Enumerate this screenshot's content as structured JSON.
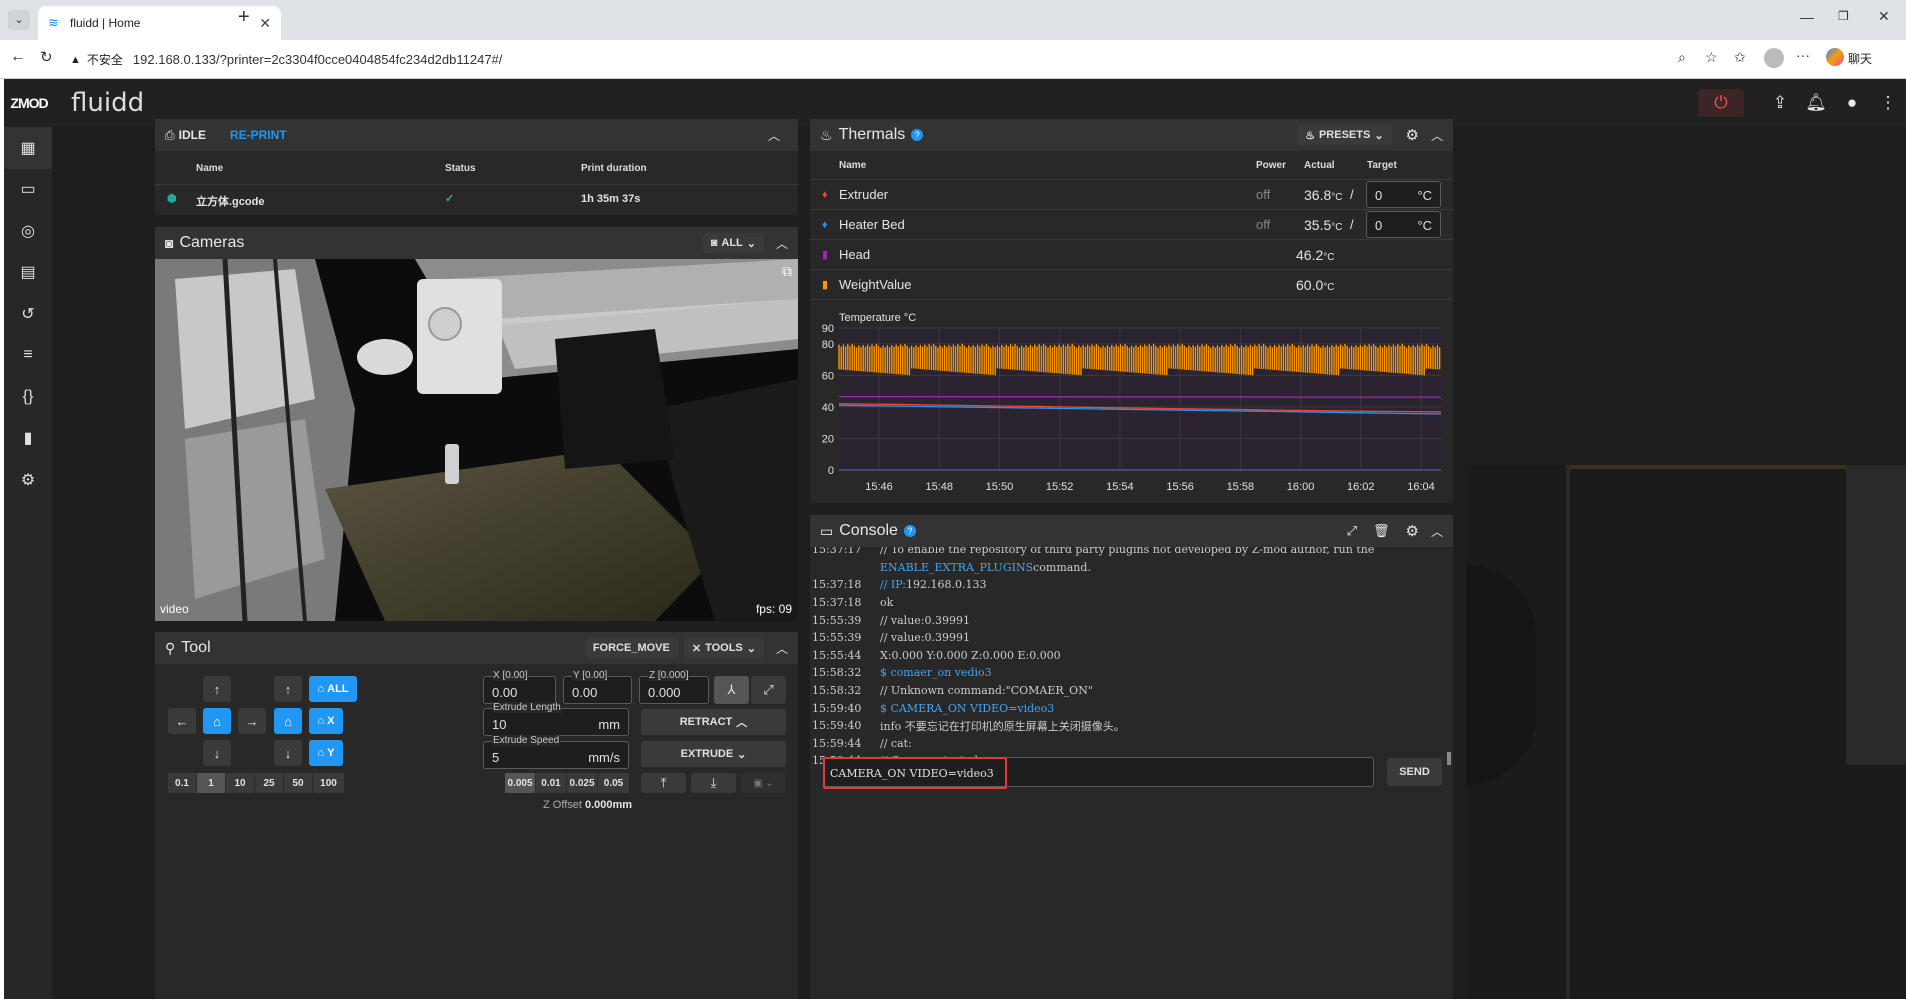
{
  "browser": {
    "tab_title": "fluidd | Home",
    "security_label": "不安全",
    "url": "192.168.0.133/?printer=2c3304f0cce0404854fc234d2db11247#/",
    "profile_label": "聊天"
  },
  "app": {
    "logo": "ZMOD",
    "brand": "fluidd"
  },
  "sidebar": {
    "items": [
      "dashboard",
      "console",
      "camera",
      "files",
      "history",
      "tune",
      "macros",
      "system",
      "settings"
    ]
  },
  "job": {
    "state": "IDLE",
    "reprint": "RE-PRINT",
    "columns": [
      "Name",
      "Status",
      "Print duration"
    ],
    "file": "立方体.gcode",
    "duration": "1h 35m 37s"
  },
  "cameras": {
    "title": "Cameras",
    "all_button": "ALL",
    "label": "video",
    "fps": "fps: 09"
  },
  "tool": {
    "title": "Tool",
    "force_move": "FORCE_MOVE",
    "tools": "TOOLS",
    "home_all": "ALL",
    "home_x": "X",
    "home_y": "Y",
    "steps": [
      "0.1",
      "1",
      "10",
      "25",
      "50",
      "100"
    ],
    "x_label": "X [0.00]",
    "x_val": "0.00",
    "y_label": "Y [0.00]",
    "y_val": "0.00",
    "z_label": "Z [0.000]",
    "z_val": "0.000",
    "extrude_length_label": "Extrude Length",
    "extrude_length": "10",
    "extrude_length_unit": "mm",
    "extrude_speed_label": "Extrude Speed",
    "extrude_speed": "5",
    "extrude_speed_unit": "mm/s",
    "retract": "RETRACT",
    "extrude": "EXTRUDE",
    "zsteps": [
      "0.005",
      "0.01",
      "0.025",
      "0.05"
    ],
    "z_offset_label": "Z Offset",
    "z_offset": "0.000mm"
  },
  "thermals": {
    "title": "Thermals",
    "presets": "PRESETS",
    "columns": {
      "name": "Name",
      "power": "Power",
      "actual": "Actual",
      "target": "Target"
    },
    "rows": [
      {
        "name": "Extruder",
        "power": "off",
        "actual": "36.8",
        "unit": "°C",
        "target": "0",
        "color": "#f44336"
      },
      {
        "name": "Heater Bed",
        "power": "off",
        "actual": "35.5",
        "unit": "°C",
        "target": "0",
        "color": "#2196f3"
      },
      {
        "name": "Head",
        "power": "",
        "actual": "46.2",
        "unit": "°C",
        "target": "",
        "color": "#9c27b0"
      },
      {
        "name": "WeightValue",
        "power": "",
        "actual": "60.0",
        "unit": "°C",
        "target": "",
        "color": "#ff9800"
      }
    ],
    "target_unit": "°C",
    "separator": "/"
  },
  "chart_data": {
    "type": "line",
    "ylabel": "Temperature °C",
    "ylim": [
      0,
      90
    ],
    "yticks": [
      0,
      20,
      40,
      60,
      80,
      90
    ],
    "x": [
      "15:46",
      "15:48",
      "15:50",
      "15:52",
      "15:54",
      "15:56",
      "15:58",
      "16:00",
      "16:02",
      "16:04"
    ],
    "series": [
      {
        "name": "WeightValue",
        "color": "#ff9800",
        "values": [
          60,
          80,
          60,
          80,
          60,
          80,
          60,
          80,
          60,
          80
        ]
      },
      {
        "name": "Head",
        "color": "#9c27b0",
        "values": [
          46.5,
          46.5,
          46.4,
          46.4,
          46.3,
          46.3,
          46.3,
          46.2,
          46.2,
          46.2
        ]
      },
      {
        "name": "Extruder",
        "color": "#f44336",
        "values": [
          42,
          41.5,
          40.8,
          40.2,
          39.5,
          38.9,
          38.3,
          37.7,
          37.2,
          36.8
        ]
      },
      {
        "name": "Heater Bed",
        "color": "#2196f3",
        "values": [
          41,
          40.4,
          39.8,
          39.2,
          38.6,
          38,
          37.4,
          36.8,
          36.1,
          35.5
        ]
      }
    ]
  },
  "console": {
    "title": "Console",
    "lines": [
      {
        "t": "15:37:17",
        "m": "// To enable the repository of third party plugins not developed by Z-mod author, run the",
        "blue": false
      },
      {
        "t": "",
        "m": "ENABLE_EXTRA_PLUGINS",
        "blue": true,
        "tail": " command."
      },
      {
        "t": "15:37:18",
        "m": "// IP:",
        "blue": false,
        "ip": " 192.168.0.133"
      },
      {
        "t": "15:37:18",
        "m": "ok",
        "blue": false
      },
      {
        "t": "15:55:39",
        "m": "// value:0.39991",
        "blue": false
      },
      {
        "t": "15:55:39",
        "m": "// value:0.39991",
        "blue": false
      },
      {
        "t": "15:55:44",
        "m": "X:0.000 Y:0.000 Z:0.000 E:0.000",
        "blue": false
      },
      {
        "t": "15:58:32",
        "m": "$ comaer_on vedio3",
        "blue": true
      },
      {
        "t": "15:58:32",
        "m": "// Unknown command:\"COMAER_ON\"",
        "blue": false
      },
      {
        "t": "15:59:40",
        "m": "$ CAMERA_ON VIDEO=video3",
        "blue": true
      },
      {
        "t": "15:59:40",
        "m": "info 不要忘记在打印机的原生屏幕上关闭摄像头。",
        "blue": false
      },
      {
        "t": "15:59:44",
        "m": "// cat:",
        "blue": false
      },
      {
        "t": "15:59:44",
        "m": "// Camera started",
        "blue": false
      }
    ],
    "input": "CAMERA_ON VIDEO=video3",
    "send": "SEND"
  }
}
